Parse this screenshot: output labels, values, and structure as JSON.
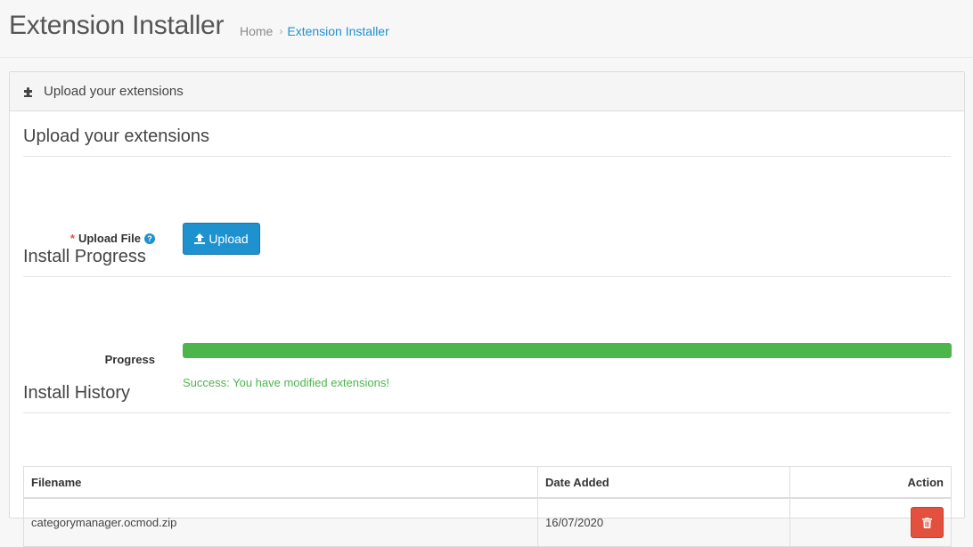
{
  "header": {
    "title": "Extension Installer",
    "breadcrumb": [
      {
        "label": "Home"
      },
      {
        "label": "Extension Installer"
      }
    ],
    "breadcrumb_separator": "›"
  },
  "panel": {
    "heading": "Upload your extensions",
    "heading_icon": "puzzle-icon"
  },
  "upload_section": {
    "title": "Upload your extensions",
    "required_mark": "*",
    "field_label": "Upload File",
    "help_icon": "?",
    "button_label": "Upload"
  },
  "progress_section": {
    "title": "Install Progress",
    "label": "Progress",
    "percent": 100,
    "message": "Success: You have modified extensions!",
    "bar_color": "#4cb64c"
  },
  "history_section": {
    "title": "Install History",
    "columns": {
      "filename": "Filename",
      "date_added": "Date Added",
      "action": "Action"
    },
    "rows": [
      {
        "filename": "categorymanager.ocmod.zip",
        "date_added": "16/07/2020"
      }
    ]
  },
  "colors": {
    "primary": "#1e91cf",
    "danger": "#e3503e",
    "success": "#4cb64c"
  }
}
